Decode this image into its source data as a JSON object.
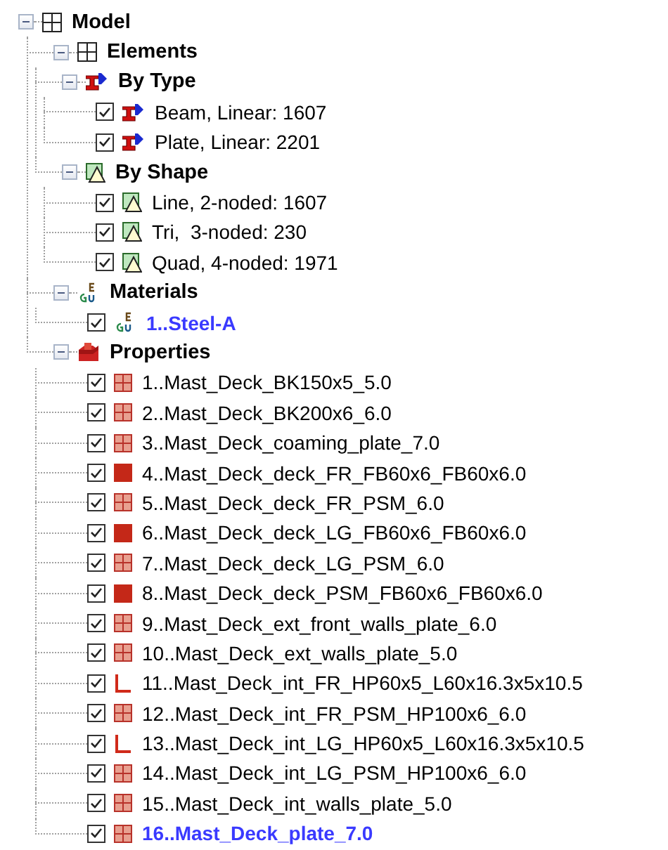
{
  "tree": [
    {
      "kind": "grid",
      "label": "Model",
      "expanded": true,
      "children": [
        {
          "kind": "grid",
          "label": "Elements",
          "expanded": true,
          "children": [
            {
              "kind": "beam",
              "label": "By Type",
              "expanded": true,
              "children": [
                {
                  "kind": "beam",
                  "label": "Beam, Linear: 1607",
                  "checked": true,
                  "current": false
                },
                {
                  "kind": "beam",
                  "label": "Plate, Linear: 2201",
                  "checked": true,
                  "current": false
                }
              ]
            },
            {
              "kind": "shape",
              "label": "By Shape",
              "expanded": true,
              "children": [
                {
                  "kind": "shape",
                  "label": "Line, 2-noded: 1607",
                  "checked": true,
                  "current": false
                },
                {
                  "kind": "shape",
                  "label": "Tri,  3-noded: 230",
                  "checked": true,
                  "current": false
                },
                {
                  "kind": "shape",
                  "label": "Quad, 4-noded: 1971",
                  "checked": true,
                  "current": false
                }
              ]
            }
          ]
        },
        {
          "kind": "material",
          "label": "Materials",
          "expanded": true,
          "children": [
            {
              "kind": "material",
              "label": "1..Steel-A",
              "checked": true,
              "current": true
            }
          ]
        },
        {
          "kind": "block",
          "label": "Properties",
          "expanded": true,
          "children": [
            {
              "kind": "plate",
              "label": "1..Mast_Deck_BK150x5_5.0",
              "checked": true,
              "current": false
            },
            {
              "kind": "plate",
              "label": "2..Mast_Deck_BK200x6_6.0",
              "checked": true,
              "current": false
            },
            {
              "kind": "plate",
              "label": "3..Mast_Deck_coaming_plate_7.0",
              "checked": true,
              "current": false
            },
            {
              "kind": "solid",
              "label": "4..Mast_Deck_deck_FR_FB60x6_FB60x6.0",
              "checked": true,
              "current": false
            },
            {
              "kind": "plate",
              "label": "5..Mast_Deck_deck_FR_PSM_6.0",
              "checked": true,
              "current": false
            },
            {
              "kind": "solid",
              "label": "6..Mast_Deck_deck_LG_FB60x6_FB60x6.0",
              "checked": true,
              "current": false
            },
            {
              "kind": "plate",
              "label": "7..Mast_Deck_deck_LG_PSM_6.0",
              "checked": true,
              "current": false
            },
            {
              "kind": "solid",
              "label": "8..Mast_Deck_deck_PSM_FB60x6_FB60x6.0",
              "checked": true,
              "current": false
            },
            {
              "kind": "plate",
              "label": "9..Mast_Deck_ext_front_walls_plate_6.0",
              "checked": true,
              "current": false
            },
            {
              "kind": "plate",
              "label": "10..Mast_Deck_ext_walls_plate_5.0",
              "checked": true,
              "current": false
            },
            {
              "kind": "angle",
              "label": "11..Mast_Deck_int_FR_HP60x5_L60x16.3x5x10.5",
              "checked": true,
              "current": false
            },
            {
              "kind": "plate",
              "label": "12..Mast_Deck_int_FR_PSM_HP100x6_6.0",
              "checked": true,
              "current": false
            },
            {
              "kind": "angle",
              "label": "13..Mast_Deck_int_LG_HP60x5_L60x16.3x5x10.5",
              "checked": true,
              "current": false
            },
            {
              "kind": "plate",
              "label": "14..Mast_Deck_int_LG_PSM_HP100x6_6.0",
              "checked": true,
              "current": false
            },
            {
              "kind": "plate",
              "label": "15..Mast_Deck_int_walls_plate_5.0",
              "checked": true,
              "current": false
            },
            {
              "kind": "plate",
              "label": "16..Mast_Deck_plate_7.0",
              "checked": true,
              "current": true
            }
          ]
        }
      ]
    }
  ]
}
